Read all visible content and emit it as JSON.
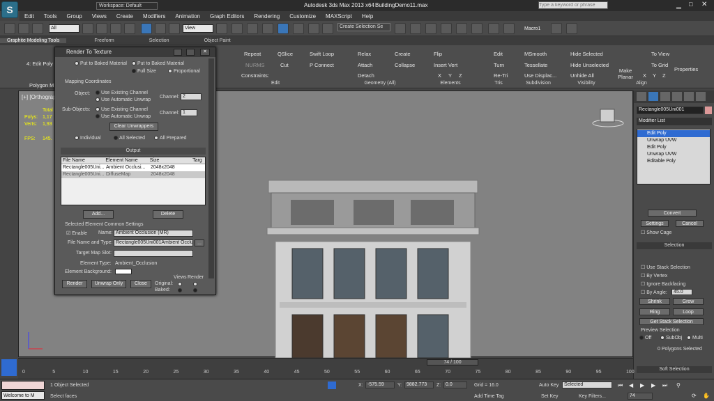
{
  "app": {
    "title": "Autodesk 3ds Max  2013 x64",
    "file": "BuildingDemo11.max",
    "workspace": "Workspace: Default",
    "search_placeholder": "Type a keyword or phrase"
  },
  "menu": [
    "Edit",
    "Tools",
    "Group",
    "Views",
    "Create",
    "Modifiers",
    "Animation",
    "Graph Editors",
    "Rendering",
    "Customize",
    "MAXScript",
    "Help"
  ],
  "toolbar": {
    "filter": "All",
    "ref_coord": "View",
    "selection_set": "Create Selection Se",
    "macro": "Macro1"
  },
  "ribbon_tabs": [
    "Graphite Modeling Tools",
    "Freeform",
    "Selection",
    "Object Paint"
  ],
  "ribbon_left": {
    "mode": "4: Edit Poly",
    "group": "Polygon M"
  },
  "ribbon_items": {
    "repeat": "Repeat",
    "qslice": "QSlice",
    "swift_loop": "Swift Loop",
    "nurms": "NURMS",
    "cut": "Cut",
    "p_connect": "P Connect",
    "constraints": "Constraints:",
    "relax": "Relax",
    "create": "Create",
    "attach": "Attach",
    "collapse": "Collapse",
    "detach": "Detach",
    "flip": "Flip",
    "insert_vert": "Insert Vert",
    "edit": "Edit",
    "turn": "Turn",
    "retri": "Re-Tri",
    "msmooth": "MSmooth",
    "tessellate": "Tessellate",
    "use_displac": "Use Displac...",
    "hide_selected": "Hide Selected",
    "hide_unselected": "Hide Unselected",
    "unhide_all": "Unhide All",
    "make_planar": "Make Planar",
    "to_view": "To View",
    "to_grid": "To Grid",
    "properties": "Properties",
    "x": "X",
    "y": "Y",
    "z": "Z"
  },
  "ribbon_groups": {
    "edit": "Edit",
    "geometry": "Geometry (All)",
    "elements": "Elements",
    "tris": "Tris",
    "subdivision": "Subdivision",
    "visibility": "Visibility",
    "align": "Align"
  },
  "viewport": {
    "label": "[+] [Orthograp",
    "stats": {
      "total": "Total",
      "polys": "Polys:",
      "polys_val": "1,17",
      "verts": "Verts:",
      "verts_val": "1,93",
      "fps": "FPS:",
      "fps_val": "145."
    }
  },
  "dialog": {
    "title": "Render To Texture",
    "top_options": {
      "put_baked": "Put to Baked Material",
      "put_baked2": "Put to Baked Material",
      "full_size": "Full Size",
      "proportional": "Proportional"
    },
    "mapping": {
      "header": "Mapping Coordinates",
      "object": "Object:",
      "use_existing": "Use Existing Channel",
      "use_auto": "Use Automatic Unwrap",
      "channel": "Channel:",
      "channel_val": "2",
      "sub_objects": "Sub-Objects:",
      "sub_existing": "Use Existing Channel",
      "sub_auto": "Use Automatic Unwrap",
      "sub_channel": "Channel:",
      "sub_channel_val": "1",
      "clear": "Clear Unwrappers"
    },
    "scope": {
      "individual": "Individual",
      "all_selected": "All Selected",
      "all_prepared": "All Prepared"
    },
    "output": {
      "header": "Output",
      "columns": [
        "File Name",
        "Element Name",
        "Size",
        "Targ"
      ],
      "rows": [
        [
          "Rectangle005Uni...",
          "Ambient Occlusi...",
          "2048x2048",
          ""
        ],
        [
          "Rectangle005Uni...",
          "DiffuseMap",
          "2048x2048",
          ""
        ]
      ],
      "add": "Add...",
      "delete": "Delete"
    },
    "element": {
      "header": "Selected Element Common Settings",
      "enable": "Enable",
      "name_label": "Name:",
      "name_val": "Ambient Occlusion (MR)",
      "file_label": "File Name and Type:",
      "file_val": "Rectangle005Uni001Ambient Occlu",
      "browse": "...",
      "target_label": "Target Map Slot:",
      "type_label": "Element Type:",
      "type_val": "Ambient_Occlusion",
      "bg_label": "Element Background:"
    },
    "bottom": {
      "render": "Render",
      "unwrap_only": "Unwrap Only",
      "close": "Close",
      "views": "Views",
      "render_col": "Render",
      "original": "Original:",
      "baked": "Baked:"
    }
  },
  "cmd": {
    "object_name": "Rectangle005Uni001",
    "modifier_list": "Modifier List",
    "stack": [
      "Edit Poly",
      "Unwrap UVW",
      "Edit Poly",
      "Unwrap UVW",
      "Editable Poly"
    ],
    "convert": "Convert",
    "settings": "Settings",
    "cancel": "Cancel",
    "show_cage": "Show Cage",
    "selection": "Selection",
    "use_stack": "Use Stack Selection",
    "by_vertex": "By Vertex",
    "ignore_backfacing": "Ignore Backfacing",
    "by_angle": "By Angle:",
    "angle_val": "45.0",
    "shrink": "Shrink",
    "grow": "Grow",
    "ring": "Ring",
    "loop": "Loop",
    "get_stack": "Get Stack Selection",
    "preview": "Preview Selection",
    "off": "Off",
    "subobj": "SubObj",
    "multi": "Multi",
    "polys_selected": "0 Polygons Selected",
    "soft_selection": "Soft Selection"
  },
  "timeline": {
    "frame": "74 / 100",
    "ticks": [
      "0",
      "5",
      "10",
      "15",
      "20",
      "25",
      "30",
      "35",
      "40",
      "45",
      "50",
      "55",
      "60",
      "65",
      "70",
      "75",
      "80",
      "85",
      "90",
      "95",
      "100"
    ]
  },
  "status": {
    "welcome": "Welcome to M",
    "objects_selected": "1 Object Selected",
    "prompt": "Select faces",
    "x_label": "X:",
    "x_val": "-575.59",
    "y_label": "Y:",
    "y_val": "9882.773",
    "z_label": "Z:",
    "z_val": "0.0",
    "grid": "Grid = 16.0",
    "add_time_tag": "Add Time Tag",
    "auto_key": "Auto Key",
    "selected": "Selected",
    "set_key": "Set Key",
    "key_filters": "Key Filters...",
    "frame_val": "74"
  },
  "colors": {
    "accent": "#3a76b8",
    "chrome": "#4a4a4a",
    "viewport": "#828282",
    "stack_highlight": "#2f6bd1"
  }
}
